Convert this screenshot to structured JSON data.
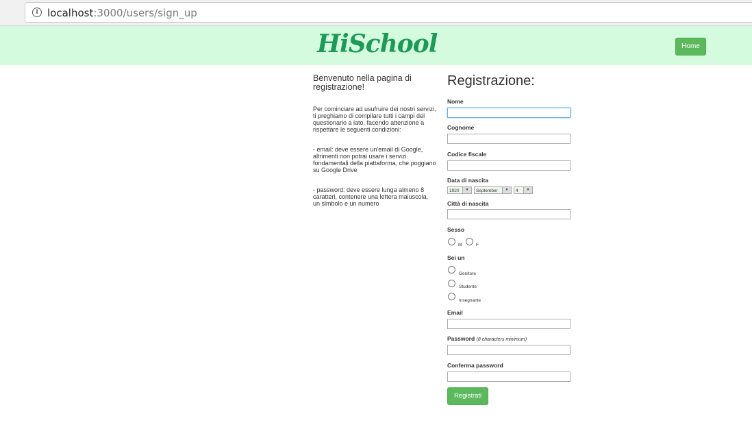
{
  "browser": {
    "url_host": "localhost",
    "url_rest": ":3000/users/sign_up",
    "info_icon": "info-icon"
  },
  "navbar": {
    "logo": "HiSchool",
    "home_label": "Home",
    "colors": {
      "background": "#d5fbdf",
      "logo": "#1e9a58",
      "button": "#5cb85c"
    }
  },
  "intro": {
    "welcome": "Benvenuto nella pagina di registrazione!",
    "paragraphs": [
      "Per cominciare ad usufruire dei nostri servizi, ti preghiamo di compilare tutti i campi del questionario a lato, facendo attenzione a rispettare le seguenti condizioni:",
      "- email: deve essere un'email di Google, altrimenti non potrai usare i servizi fondamentali della piattaforma, che poggiano su Google Drive",
      "- password: deve essere lunga almeno 8 caratteri, contenere una lettera maiuscola, un simbolo e un numero"
    ]
  },
  "form": {
    "title": "Registrazione:",
    "nome_label": "Nome",
    "cognome_label": "Cognome",
    "codice_label": "Codice fiscale",
    "data_label": "Data di nascita",
    "birth_year": "1920",
    "birth_month": "September",
    "birth_day": "4",
    "citta_label": "Città di nascita",
    "sesso_label": "Sesso",
    "sesso_options": [
      "M",
      "F"
    ],
    "ruolo_label": "Sei un",
    "ruolo_options": [
      "Genitore",
      "Studente",
      "Insegnante"
    ],
    "email_label": "Email",
    "password_label": "Password",
    "password_hint": "(8 characters minimum)",
    "conferma_label": "Conferma password",
    "submit_label": "Registrati"
  }
}
